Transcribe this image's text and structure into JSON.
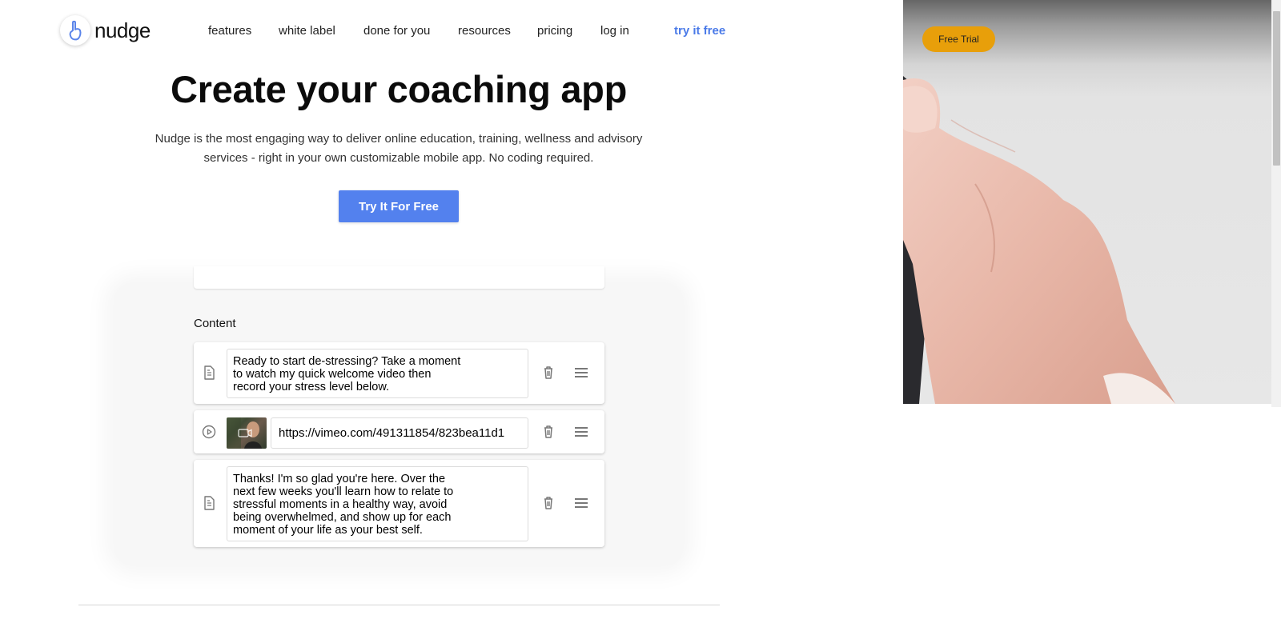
{
  "brand": {
    "name": "nudge"
  },
  "nav": {
    "items": [
      {
        "label": "features"
      },
      {
        "label": "white label"
      },
      {
        "label": "done for you"
      },
      {
        "label": "resources"
      },
      {
        "label": "pricing"
      },
      {
        "label": "log in"
      }
    ],
    "cta_label": "try it free",
    "cta_color": "#4a7ae8"
  },
  "hero": {
    "title": "Create your coaching app",
    "subtitle_line1": "Nudge is the most engaging way to deliver online education, training, wellness and advisory",
    "subtitle_line2": "services - right in your own customizable mobile app. No coding required.",
    "button_label": "Try It For Free",
    "button_color": "#5381ee"
  },
  "editor": {
    "section_label": "Content",
    "items": [
      {
        "type": "text",
        "type_icon": "document-icon",
        "text": "Ready to start de-stressing? Take a moment\nto watch my quick welcome video then\nrecord your stress level below."
      },
      {
        "type": "video",
        "type_icon": "play-circle-icon",
        "url": "https://vimeo.com/491311854/823bea11d1"
      },
      {
        "type": "text",
        "type_icon": "document-icon",
        "text": "Thanks! I'm so glad you're here. Over the\nnext few weeks you'll learn how to relate to\nstressful moments in a healthy way, avoid\nbeing overwhelmed, and show up for each\nmoment of your life as your best self."
      }
    ]
  },
  "side": {
    "free_trial_label": "Free Trial",
    "free_trial_color": "#e89f0a"
  }
}
